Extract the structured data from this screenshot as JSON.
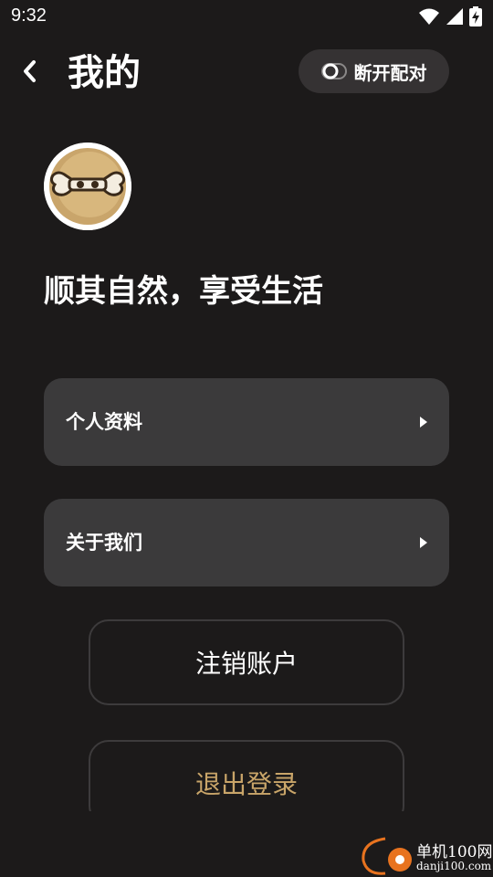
{
  "status_bar": {
    "time": "9:32",
    "icons": [
      "wifi-icon",
      "signal-icon",
      "battery-charging-icon"
    ]
  },
  "header": {
    "back_icon": "chevron-left-icon",
    "title": "我的",
    "disconnect_label": "断开配对",
    "disconnect_icon": "toggle-icon"
  },
  "profile": {
    "avatar": "bone-avatar",
    "motto": "顺其自然，享受生活"
  },
  "menu": [
    {
      "label": "个人资料",
      "icon": "triangle-right-icon"
    },
    {
      "label": "关于我们",
      "icon": "triangle-right-icon"
    }
  ],
  "actions": {
    "deactivate_label": "注销账户",
    "logout_label": "退出登录"
  },
  "watermark": {
    "title": "单机100网",
    "subtitle": "danji100.com"
  },
  "colors": {
    "background": "#1c1a1a",
    "card": "#3b3a3b",
    "pill": "#353233",
    "accent_gold": "#c9a569",
    "avatar_tan": "#c9a56b"
  }
}
